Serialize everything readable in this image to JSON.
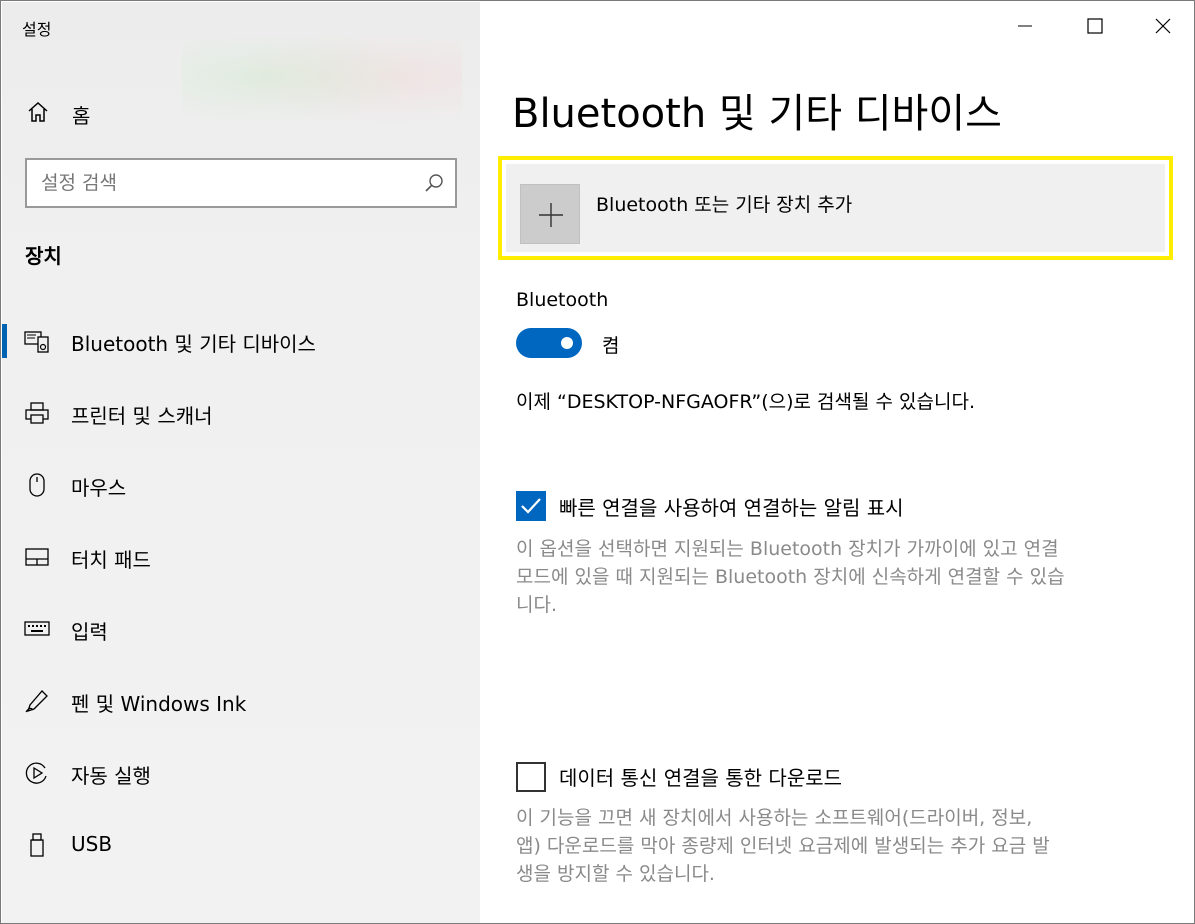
{
  "window": {
    "title": "설정",
    "controls": {
      "minimize": "minimize-icon",
      "maximize": "maximize-icon",
      "close": "close-icon"
    }
  },
  "sidebar": {
    "home_label": "홈",
    "search": {
      "placeholder": "설정 검색",
      "value": ""
    },
    "section_title": "장치",
    "items": [
      {
        "label": "Bluetooth 및 기타 디바이스",
        "icon": "bluetooth-devices-icon",
        "selected": true
      },
      {
        "label": "프린터 및 스캐너",
        "icon": "printer-icon"
      },
      {
        "label": "마우스",
        "icon": "mouse-icon"
      },
      {
        "label": "터치 패드",
        "icon": "touchpad-icon"
      },
      {
        "label": "입력",
        "icon": "keyboard-icon"
      },
      {
        "label": "펜 및 Windows Ink",
        "icon": "pen-icon"
      },
      {
        "label": "자동 실행",
        "icon": "autoplay-icon"
      },
      {
        "label": "USB",
        "icon": "usb-icon"
      }
    ]
  },
  "main": {
    "title": "Bluetooth 및 기타 디바이스",
    "add_device_label": "Bluetooth 또는 기타 장치 추가",
    "bluetooth_label": "Bluetooth",
    "bluetooth_state": "켬",
    "discoverable_text": "이제 “DESKTOP-NFGAOFR”(으)로 검색될 수 있습니다.",
    "swift_pair": {
      "label": "빠른 연결을 사용하여 연결하는 알림 표시",
      "checked": true,
      "description": [
        "이 옵션을 선택하면 지원되는 Bluetooth 장치가 가까이에 있고 연결",
        "모드에 있을 때 지원되는 Bluetooth 장치에 신속하게 연결할 수 있습",
        "니다."
      ]
    },
    "metered_download": {
      "label": "데이터 통신 연결을 통한 다운로드",
      "checked": false,
      "description": [
        "이 기능을 끄면 새 장치에서 사용하는 소프트웨어(드라이버, 정보,",
        "앱) 다운로드를 막아 종량제 인터넷 요금제에 발생되는 추가 요금 발",
        "생을 방지할 수 있습니다."
      ]
    },
    "colors": {
      "accent": "#0067c0",
      "highlight": "#ffee00"
    }
  }
}
